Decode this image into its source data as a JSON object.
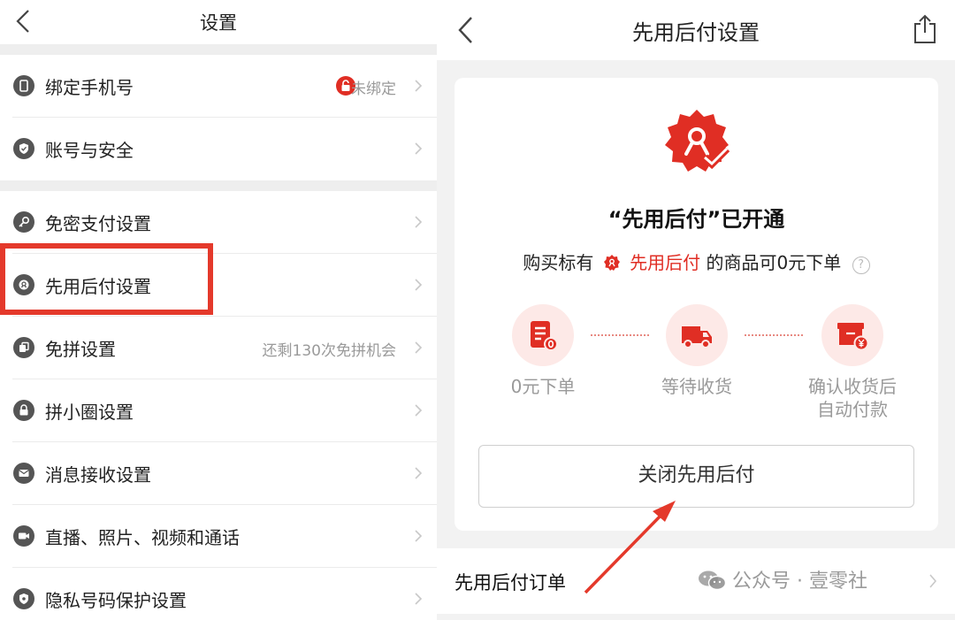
{
  "left": {
    "title": "设置",
    "rows": [
      {
        "label": "绑定手机号",
        "value": "未绑定"
      },
      {
        "label": "账号与安全",
        "value": ""
      },
      {
        "label": "免密支付设置",
        "value": ""
      },
      {
        "label": "先用后付设置",
        "value": ""
      },
      {
        "label": "免拼设置",
        "value": "还剩130次免拼机会"
      },
      {
        "label": "拼小圈设置",
        "value": ""
      },
      {
        "label": "消息接收设置",
        "value": ""
      },
      {
        "label": "直播、照片、视频和通话",
        "value": ""
      },
      {
        "label": "隐私号码保护设置",
        "value": ""
      }
    ],
    "highlight_color": "#e4392b"
  },
  "right": {
    "title": "先用后付设置",
    "card": {
      "heading": "“先用后付”已开通",
      "desc_prefix": "购买标有",
      "desc_brand": "先用后付",
      "desc_suffix": "的商品可0元下单",
      "help": "?",
      "steps": [
        {
          "label": "0元下单",
          "icon": "order-zero-icon"
        },
        {
          "label": "等待收货",
          "icon": "truck-icon"
        },
        {
          "label_line1": "确认收货后",
          "label_line2": "自动付款",
          "icon": "box-yen-icon"
        }
      ],
      "close_button": "关闭先用后付"
    },
    "orders_label": "先用后付订单",
    "watermark": "公众号 · 壹零社"
  },
  "colors": {
    "accent_red": "#e02e24",
    "page_gray": "#f2f2f2"
  }
}
